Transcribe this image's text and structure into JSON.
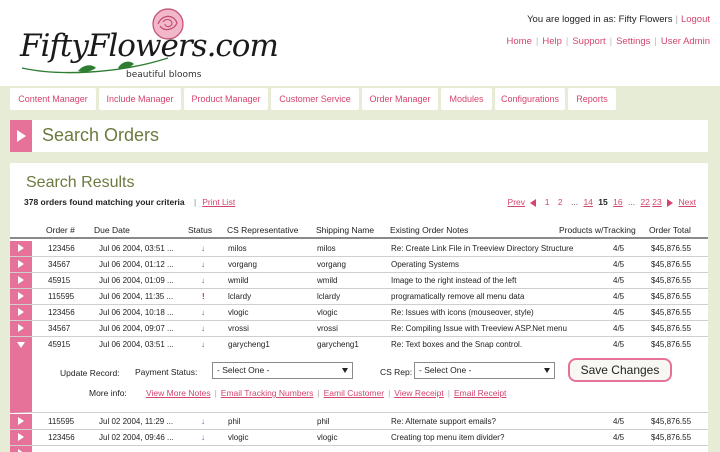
{
  "brand": {
    "logo_text": "FiftyFlowers.com",
    "tagline": "beautiful blooms",
    "colors": {
      "accent": "#e6729a",
      "link": "#d4456d",
      "olive": "#6b7a3f",
      "background": "#e6ecd6"
    }
  },
  "user": {
    "logged_in_text": "You are logged in as: Fifty Flowers",
    "logout_label": "Logout"
  },
  "toplinks": [
    "Home",
    "Help",
    "Support",
    "Settings",
    "User Admin"
  ],
  "nav": [
    "Content Manager",
    "Include Manager",
    "Product Manager",
    "Customer Service",
    "Order Manager",
    "Modules",
    "Configurations",
    "Reports"
  ],
  "page_title": "Search Orders",
  "results": {
    "title": "Search Results",
    "found_text": "378 orders found matching your criteria",
    "print_label": "Print List"
  },
  "pager": {
    "prev_label": "Prev",
    "next_label": "Next",
    "items": [
      "1",
      "2",
      "...",
      "14",
      "15",
      "16",
      "...",
      "22",
      "23"
    ],
    "current": "15"
  },
  "columns": [
    "Order #",
    "Due Date",
    "Status",
    "CS Representative",
    "Shipping Name",
    "Existing Order Notes",
    "Products w/Tracking",
    "Order Total"
  ],
  "rows": [
    {
      "order": "123456",
      "due": "Jul 06 2004, 03:51 ...",
      "status": "down",
      "rep": "milos",
      "ship": "milos",
      "notes": "Re: Create Link File in Treeview Directory Structure",
      "tracking": "4/5",
      "total": "$45,876.55"
    },
    {
      "order": "34567",
      "due": "Jul 06 2004, 01:12 ...",
      "status": "down",
      "rep": "vorgang",
      "ship": "vorgang",
      "notes": "Operating Systems",
      "tracking": "4/5",
      "total": "$45,876.55"
    },
    {
      "order": "45915",
      "due": "Jul 06 2004, 01:09 ...",
      "status": "down",
      "rep": "wmild",
      "ship": "wmild",
      "notes": "Image to the right instead of the left",
      "tracking": "4/5",
      "total": "$45,876.55"
    },
    {
      "order": "115595",
      "due": "Jul 06 2004, 11:35 ...",
      "status": "up",
      "rep": "lclardy",
      "ship": "lclardy",
      "notes": "programatically remove all menu data",
      "tracking": "4/5",
      "total": "$45,876.55"
    },
    {
      "order": "123456",
      "due": "Jul 06 2004, 10:18 ...",
      "status": "down",
      "rep": "vlogic",
      "ship": "vlogic",
      "notes": "Re: Issues with icons (mouseover, style)",
      "tracking": "4/5",
      "total": "$45,876.55"
    },
    {
      "order": "34567",
      "due": "Jul 06 2004, 09:07 ...",
      "status": "down",
      "rep": "vrossi",
      "ship": "vrossi",
      "notes": "Re: Compiling Issue with Treeview ASP.Net menu",
      "tracking": "4/5",
      "total": "$45,876.55"
    },
    {
      "order": "45915",
      "due": "Jul 06 2004, 03:51 ...",
      "status": "down",
      "rep": "garycheng1",
      "ship": "garycheng1",
      "notes": "Re: Text boxes and the Snap control.",
      "tracking": "4/5",
      "total": "$45,876.55"
    }
  ],
  "edit": {
    "update_label": "Update Record:",
    "payment_label": "Payment Status:",
    "payment_value": "- Select One -",
    "csrep_label": "CS Rep:",
    "csrep_value": "- Select One -",
    "save_label": "Save Changes",
    "more_label": "More info:",
    "links": [
      "View More Notes",
      "Email Tracking Numbers",
      "Eamil Customer",
      "View Receipt",
      "Email Receipt"
    ]
  },
  "rows_after": [
    {
      "order": "115595",
      "due": "Jul 02 2004, 11:29 ...",
      "status": "down",
      "rep": "phil",
      "ship": "phil",
      "notes": "Re: Alternate support emails?",
      "tracking": "4/5",
      "total": "$45,876.55"
    },
    {
      "order": "123456",
      "due": "Jul 02 2004, 09:46 ...",
      "status": "down",
      "rep": "vlogic",
      "ship": "vlogic",
      "notes": "Creating top menu item divider?",
      "tracking": "4/5",
      "total": "$45,876.55"
    }
  ]
}
